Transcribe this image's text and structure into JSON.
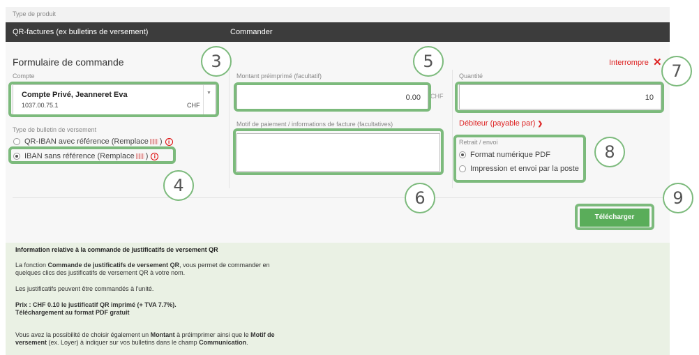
{
  "header": {
    "type_label": "Type de produit",
    "product_name": "QR-factures (ex bulletins de versement)",
    "action": "Commander"
  },
  "form": {
    "title": "Formulaire de commande",
    "interrupt_label": "Interrompre",
    "account": {
      "label": "Compte",
      "holder": "Compte Privé, Jeanneret Eva",
      "number": "1037.00.75.1",
      "currency": "CHF"
    },
    "slip_type": {
      "label": "Type de bulletin de versement",
      "options": [
        {
          "text": "QR-IBAN avec référence (Remplace",
          "suffix": ")",
          "checked": false
        },
        {
          "text": "IBAN sans référence (Remplace",
          "suffix": ")",
          "checked": true
        }
      ]
    },
    "amount": {
      "label": "Montant préimprimé (facultatif)",
      "value": "0.00",
      "currency": "CHF"
    },
    "motif": {
      "label": "Motif de paiement / informations de facture (facultatives)",
      "value": ""
    },
    "quantity": {
      "label": "Quantité",
      "value": "10"
    },
    "debtor_label": "Débiteur (payable par)",
    "delivery": {
      "label": "Retrait / envoi",
      "options": [
        {
          "text": "Format numérique PDF",
          "checked": true
        },
        {
          "text": "Impression et envoi par la poste",
          "checked": false
        }
      ]
    },
    "download_label": "Télécharger"
  },
  "callouts": [
    "3",
    "4",
    "5",
    "6",
    "7",
    "8",
    "9"
  ],
  "info": {
    "title": "Information relative à la commande de justificatifs de versement QR",
    "p1_a": "La fonction ",
    "p1_b": "Commande de justificatifs de versement QR",
    "p1_c": ", vous permet de commander en",
    "p1_d": "quelques clics des justificatifs de versement QR à votre nom.",
    "p2": "Les justificatifs peuvent être commandés à l'unité.",
    "p3_a": "Prix : CHF 0.10 le justificatif QR imprimé (+ TVA 7.7%).",
    "p3_b": "Téléchargement au format PDF gratuit",
    "p4_a": "Vous avez la possibilité de choisir également un ",
    "p4_b": "Montant",
    "p4_c": " à préimprimer ainsi que le ",
    "p4_d": "Motif de",
    "p4_e": "versement",
    "p4_f": " (ex. Loyer) à indiquer sur vos bulletins dans le champ ",
    "p4_g": "Communication",
    "p4_h": "."
  },
  "colors": {
    "highlight": "#7cba7c",
    "danger": "#dd2222",
    "button": "#5aad5a",
    "dark_bar": "#3c3c3c",
    "info_bg": "#eaf1e4"
  }
}
